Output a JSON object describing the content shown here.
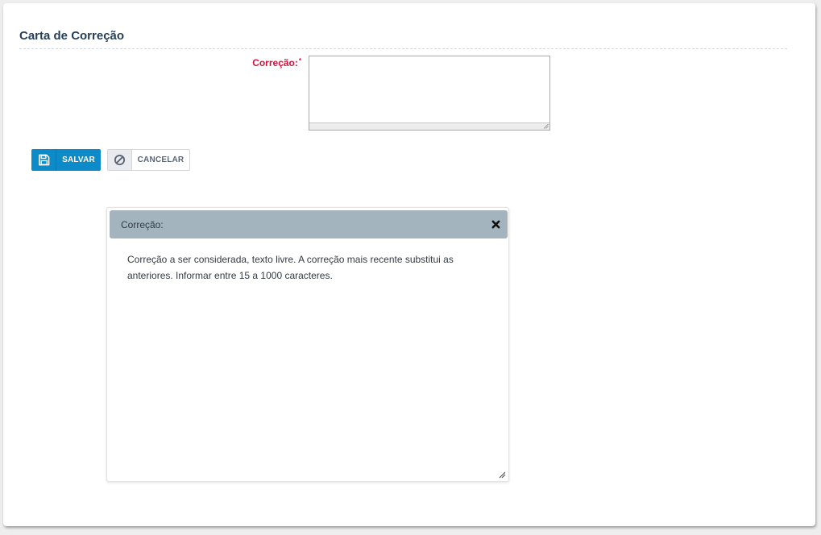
{
  "page": {
    "title": "Carta de Correção"
  },
  "form": {
    "correction_label": "Correção:",
    "required_marker": "*",
    "correction_value": "",
    "correction_placeholder": ""
  },
  "actions": {
    "save_label": "SALVAR",
    "cancel_label": "CANCELAR",
    "save_icon": "floppy-disk-icon",
    "cancel_icon": "ban-icon"
  },
  "help": {
    "title": "Correção:",
    "body": "Correção a ser considerada, texto livre. A correção mais recente substitui as anteriores. Informar entre 15 a 1000 caracteres.",
    "close_icon": "close-icon"
  },
  "colors": {
    "title": "#263f59",
    "required_label": "#d3153a",
    "primary_button": "#0d8bc8",
    "help_header": "#a4b4be"
  }
}
